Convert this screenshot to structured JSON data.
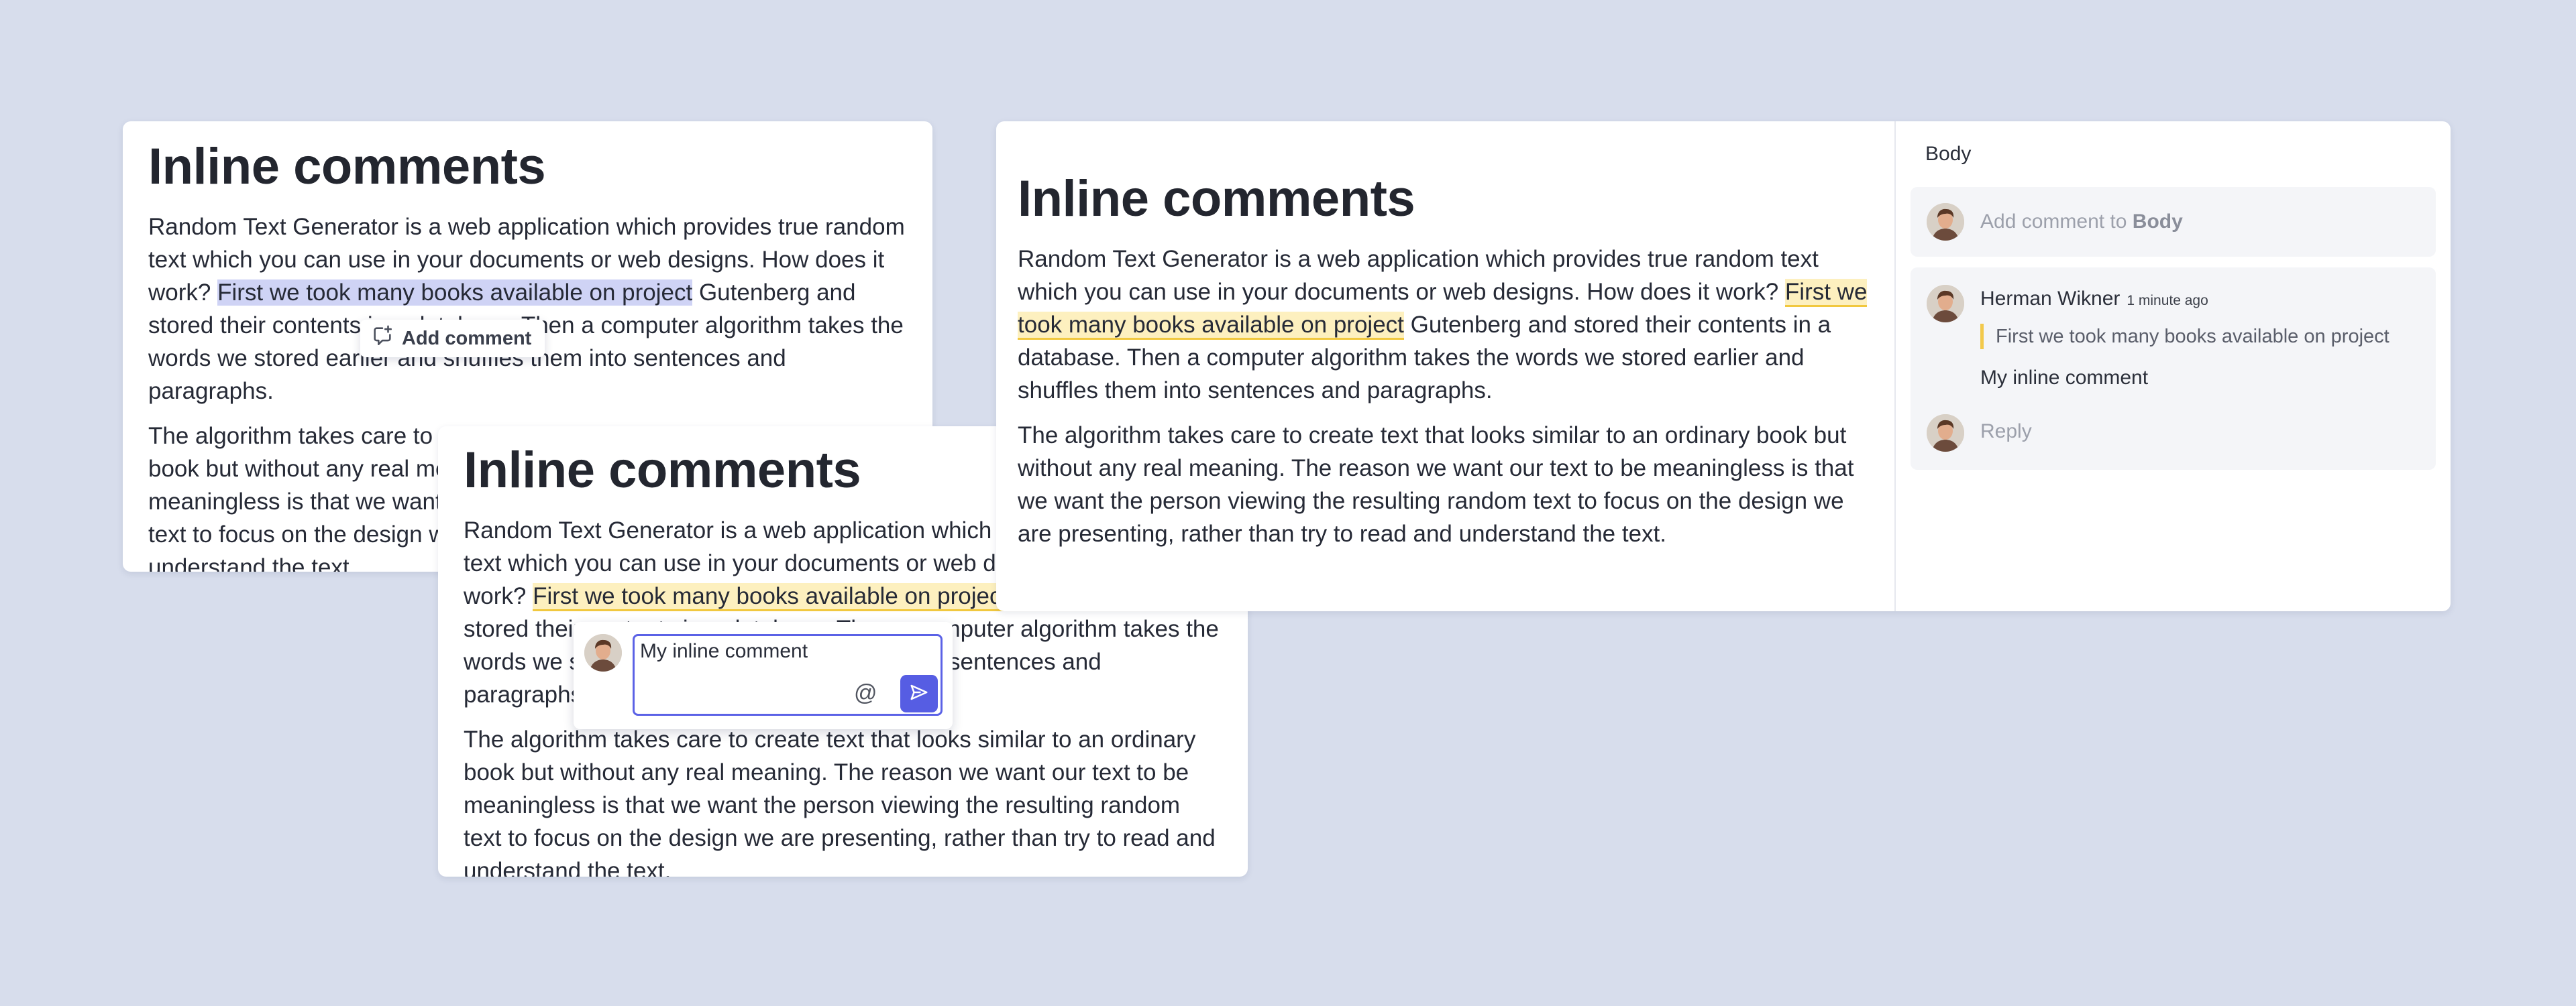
{
  "document": {
    "title": "Inline comments",
    "para1_before": "Random Text Generator is a web application which provides true random text which you can use in your documents or web designs. How does it work? ",
    "para1_highlight": "First we took many books available on project",
    "para1_after": " Gutenberg and stored their contents in a database. Then a computer algorithm takes the words we stored earlier and shuffles them into sentences and paragraphs.",
    "para2": "The algorithm takes care to create text that looks similar to an ordinary book but without any real meaning. The reason we want our text to be meaningless is that we want the person viewing the resulting random text to focus on the design we are presenting, rather than try to read and understand the text."
  },
  "selection_popover": {
    "label": "Add comment",
    "icon": "comment-plus-icon"
  },
  "comment_popover": {
    "input_value": "My inline comment",
    "mention_icon": "at-icon",
    "send_icon": "send-icon"
  },
  "comments_panel": {
    "title": "Body",
    "add_placeholder_prefix": "Add comment to ",
    "add_placeholder_target": "Body",
    "thread": {
      "author": "Herman Wikner",
      "time": "1 minute ago",
      "quote": "First we took many books available on project",
      "body": "My inline comment",
      "reply_placeholder": "Reply"
    }
  },
  "colors": {
    "background": "#d7ddec",
    "accent": "#565de3",
    "selection": "#cfd3f5",
    "highlight": "#fdf0bf",
    "highlight_border": "#f1c83f"
  }
}
